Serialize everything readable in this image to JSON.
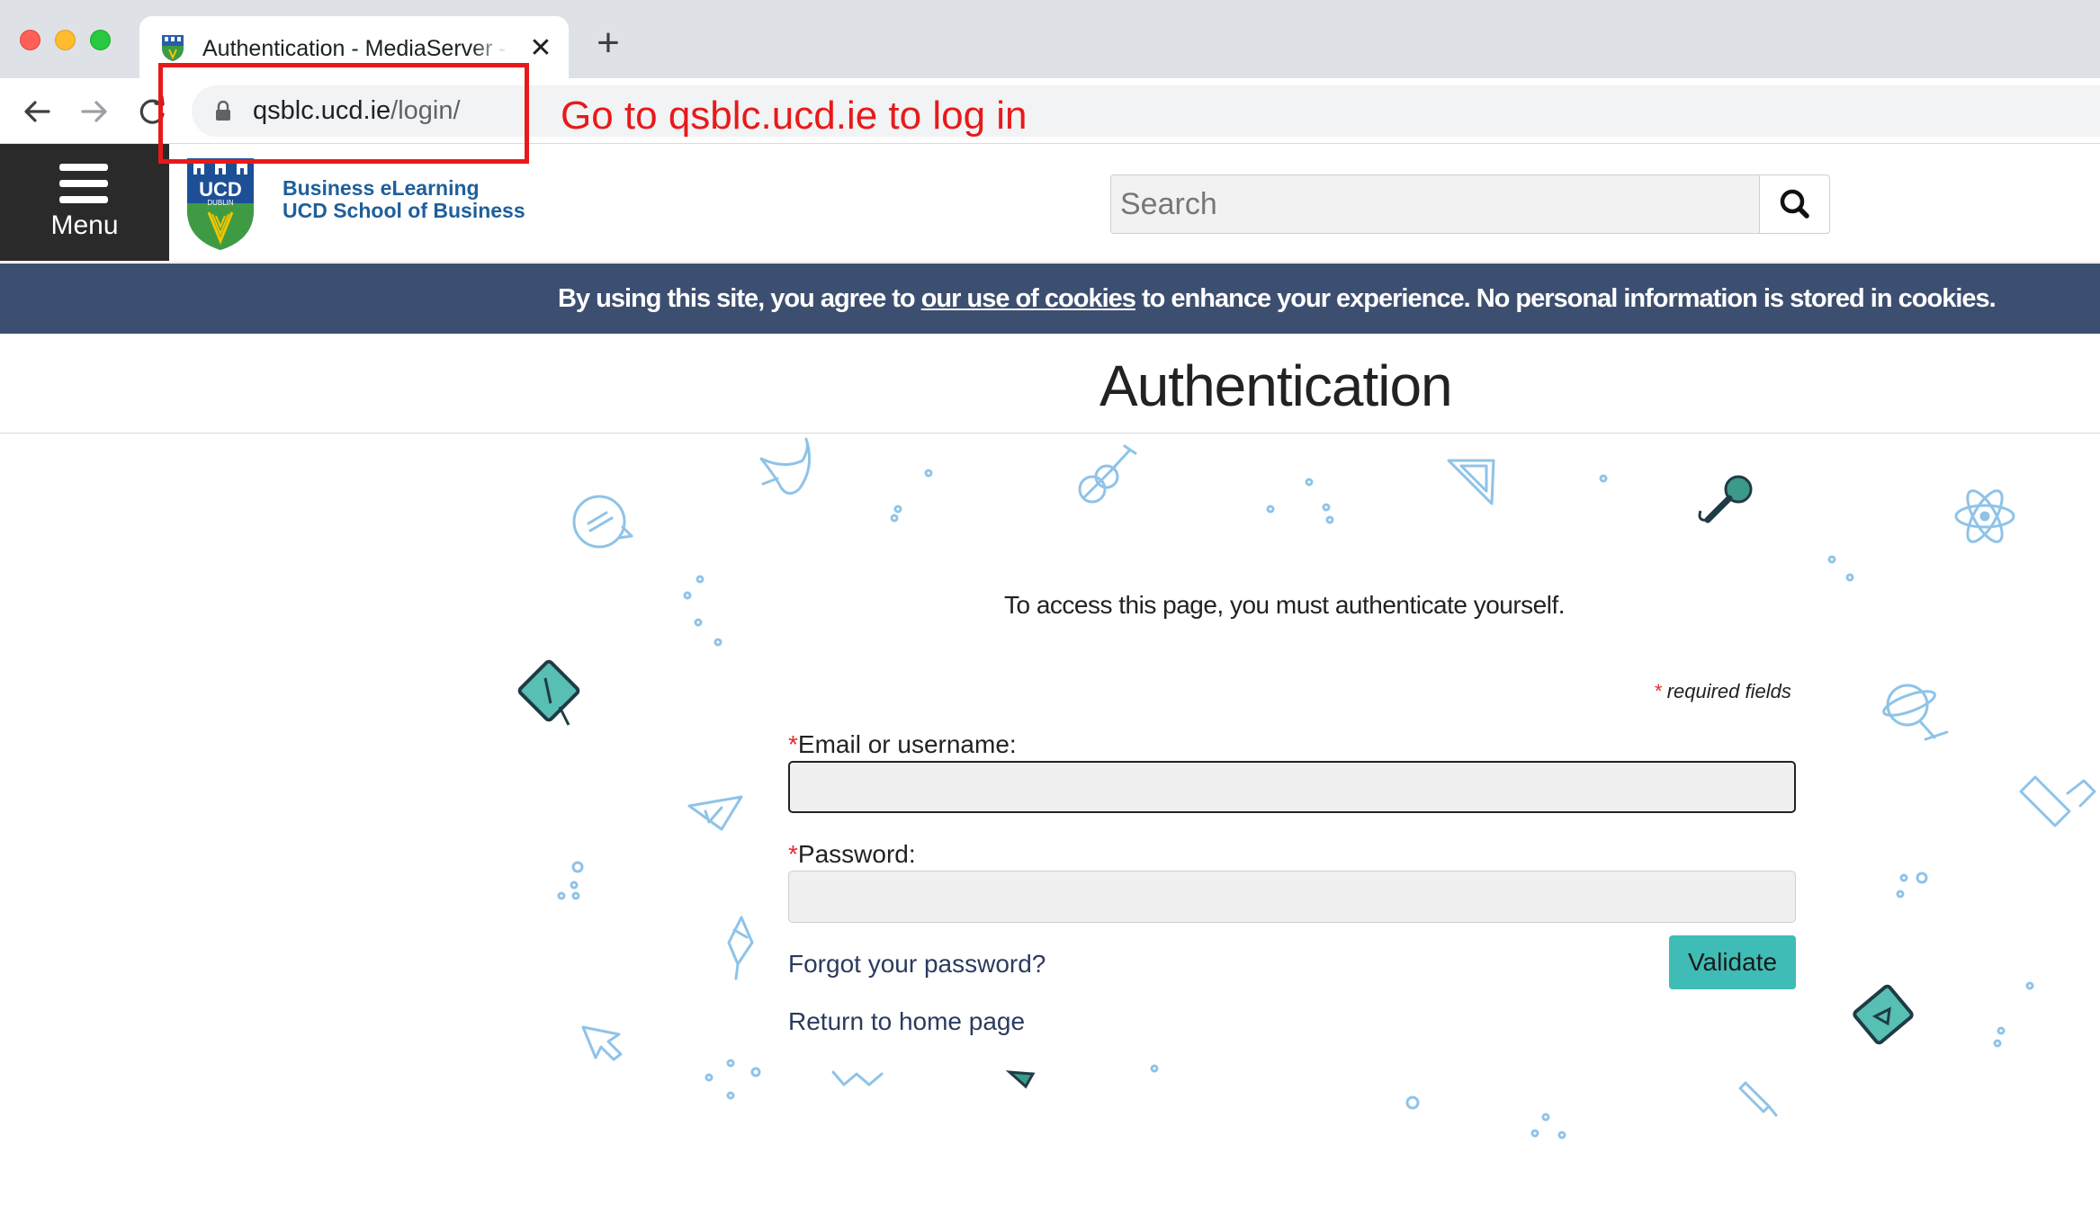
{
  "browser": {
    "tab_title": "Authentication - MediaServer - UCD",
    "url_host": "qsblc.ucd.ie",
    "url_path": "/login/"
  },
  "annotation": {
    "text": "Go to qsblc.ucd.ie to log in",
    "color": "#e8191a"
  },
  "header": {
    "menu_label": "Menu",
    "crest_ucd": "UCD",
    "crest_dublin": "DUBLIN",
    "logo_line1": "Business eLearning",
    "logo_line2": "UCD School of Business",
    "search_placeholder": "Search"
  },
  "cookie_banner": {
    "prefix": "By using this site, you agree to ",
    "link_text": "our use of cookies",
    "suffix": " to enhance your experience. No personal information is stored in cookies.",
    "background": "#3d4f70"
  },
  "page": {
    "title": "Authentication",
    "intro": "To access this page, you must authenticate yourself."
  },
  "form": {
    "required_star": "*",
    "required_note": "required fields",
    "email_label": "Email or username:",
    "password_label": "Password:",
    "email_value": "",
    "password_value": "",
    "validate_label": "Validate",
    "forgot_password": "Forgot your password?",
    "return_home": "Return to home page",
    "accent": "#3fbcb5"
  },
  "icons": {
    "favicon": "ucd-crest-icon",
    "lock": "lock-icon",
    "search": "search-icon",
    "back": "back-arrow-icon",
    "forward": "forward-arrow-icon",
    "reload": "reload-icon"
  }
}
